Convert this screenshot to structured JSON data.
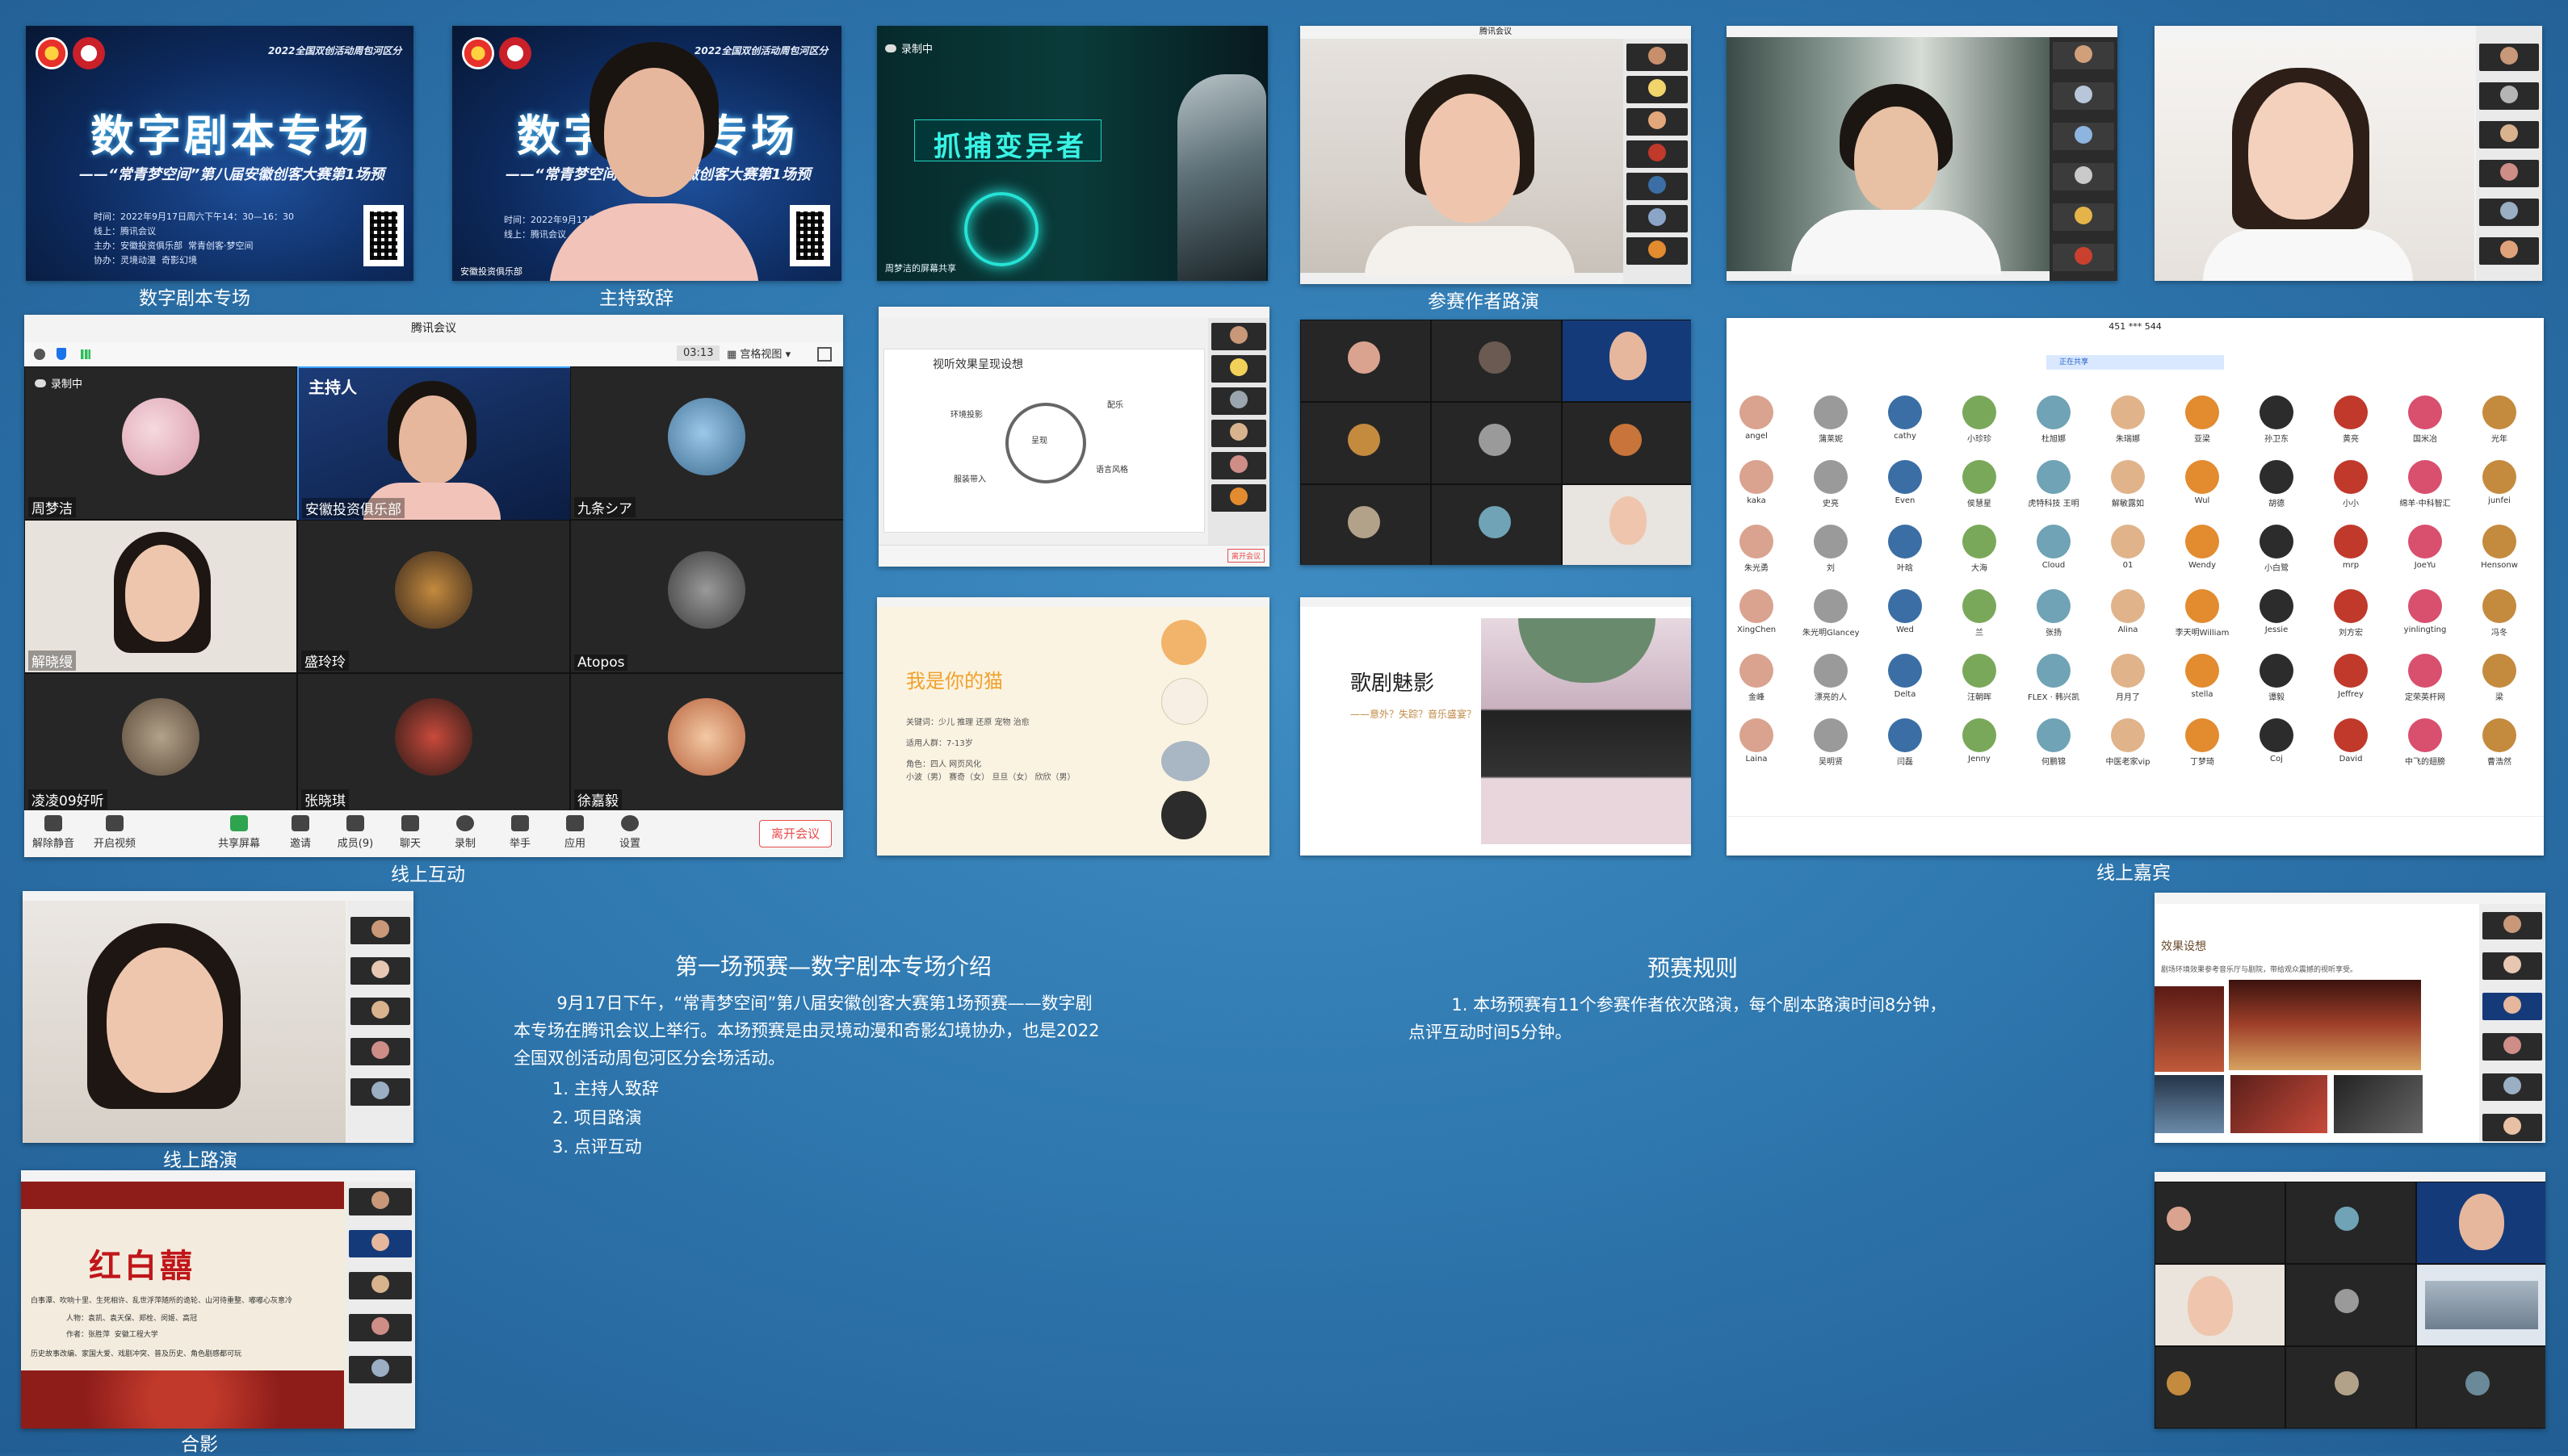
{
  "captions": {
    "poster": "数字剧本专场",
    "host": "主持致辞",
    "presenter": "参赛作者路演",
    "interaction": "线上互动",
    "guests": "线上嘉宾",
    "online_roadshow": "线上路演",
    "group_photo": "合影"
  },
  "poster": {
    "header": "2022全国双创活动周包河区分",
    "title": "数字剧本专场",
    "subtitle": "——“常青梦空间”第八届安徽创客大赛第1场预",
    "info": "时间：2022年9月17日周六下午14：30—16：30\n线上：腾讯会议\n主办：安徽投资俱乐部  常青创客·梦空间\n协办：灵境动漫  奇影幻境",
    "info_short": "时间：2022年9月17日周六\n线上：腾讯会议",
    "club_tag": "安徽投资俱乐部"
  },
  "record_badge": "录制中",
  "capture_slide": {
    "title": "抓捕变异者",
    "share_note": "周梦洁的屏幕共享"
  },
  "meeting_window": {
    "app_title": "腾讯会议",
    "timer": "03:13",
    "view_mode": "宫格视图",
    "host_badge": "主持人",
    "participants": [
      "周梦洁",
      "安徽投资俱乐部",
      "九条シア",
      "解晓缦",
      "盛玲玲",
      "Atopos",
      "凌凌09好听",
      "张晓琪",
      "徐嘉毅"
    ],
    "toolbar": [
      "解除静音",
      "开启视频",
      "共享屏幕",
      "邀请",
      "成员(9)",
      "聊天",
      "录制",
      "举手",
      "应用",
      "设置"
    ],
    "leave": "离开会议"
  },
  "slide_effect": {
    "title": "视听效果呈现设想",
    "center": "呈现",
    "nodes": [
      "环境投影",
      "配乐",
      "服装带入",
      "语言风格"
    ],
    "leave": "离开会议"
  },
  "slide_cat": {
    "title": "我是你的猫",
    "lines": [
      "关键词：少儿 推理 还原 宠物 治愈",
      "适用人群：7-13岁",
      "角色：四人 网页风化",
      "小波（男） 赛奇（女） 旦旦（女） 欣欣（男）"
    ]
  },
  "slide_opera": {
    "title": "歌剧魅影",
    "sub": "——意外？失踪？音乐盛宴？"
  },
  "guest_names": [
    "angel",
    "蒲莱妮",
    "cathy",
    "小珍珍",
    "杜旭娜",
    "朱瑞娜",
    "亚梁",
    "孙卫东",
    "黄亮",
    "国米冶",
    "光年",
    "kaka",
    "史亮",
    "Even",
    "侯慧星",
    "虎特科技 王明",
    "解敏露如",
    "Wul",
    "胡德",
    "小小",
    "绵羊·中科智汇",
    "junfei",
    "朱光勇",
    "刘",
    "叶晗",
    "大海",
    "Cloud",
    "01",
    "Wendy",
    "小白鹭",
    "mrp",
    "JoeYu",
    "Hensonw",
    "XingChen",
    "朱光明Glancey",
    "Wed",
    "兰",
    "张扬",
    "Alina",
    "李天明William",
    "Jessie",
    "刘方宏",
    "yinlingting",
    "冯冬",
    "金峰",
    "漂亮的人",
    "Delta",
    "汪朝晖",
    "FLEX · 韩兴凯",
    "月月了",
    "stella",
    "谭毅",
    "Jeffrey",
    "定荣英杆网",
    "梁",
    "Laina",
    "吴明贤",
    "闫磊",
    "Jenny",
    "何鹏锦",
    "中医老家vip",
    "丁梦琦",
    "Coj",
    "David",
    "中飞的翅膀",
    "曹浩然"
  ],
  "guest_window": {
    "id": "451 *** 544",
    "banner": "正在共享"
  },
  "intro": {
    "heading": "第一场预赛—数字剧本专场介绍",
    "para": "        9月17日下午，“常青梦空间”第八届安徽创客大赛第1场预赛——数字剧\n本专场在腾讯会议上举行。本场预赛是由灵境动漫和奇影幻境协办，也是2022\n全国双创活动周包河区分会场活动。",
    "items": [
      "1. 主持人致辞",
      "2. 项目路演",
      "3. 点评互动"
    ]
  },
  "rules": {
    "heading": "预赛规则",
    "para": "        1. 本场预赛有11个参赛作者依次路演，每个剧本路演时间8分钟，\n点评互动时间5分钟。"
  },
  "theatre_slide": {
    "title": "效果设想",
    "line": "剧场环境效果参考音乐厅与剧院，带给观众震撼的视听享受。"
  },
  "redwhite_slide": {
    "title": "红白囍",
    "lines": [
      "白事潭、吹响十里、生死相许、乱世浮萍随所的诡轮、山河待重整、嘟嘟心灰意冷",
      "人物：袁凯、袁天保、郑栓、闵姬、高冠",
      "作者：张胜萍  安徽工程大学",
      "历史故事改编、家国大爱、戏剧冲突、普及历史、角色剧感都可玩"
    ]
  },
  "colors": {
    "background": "#2f78b0",
    "meeting_dark": "#262626",
    "leave_red": "#e84c4c",
    "accent_blue": "#1a73e8"
  }
}
